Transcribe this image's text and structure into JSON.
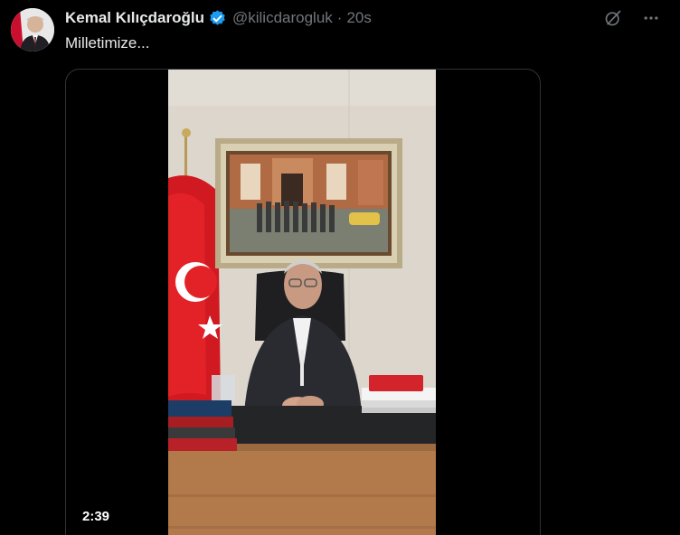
{
  "author": {
    "name": "Kemal Kılıçdaroğlu",
    "handle": "@kilicdarogluk",
    "separator": "·",
    "time": "20s"
  },
  "tweet": {
    "text": "Milletimize..."
  },
  "media": {
    "duration": "2:39"
  },
  "colors": {
    "background": "#000000",
    "text": "#e7e9ea",
    "muted": "#71767b",
    "verified": "#1d9bf0",
    "border": "#2f3336"
  },
  "icons": [
    "verified-badge-icon",
    "grok-icon",
    "more-icon"
  ]
}
